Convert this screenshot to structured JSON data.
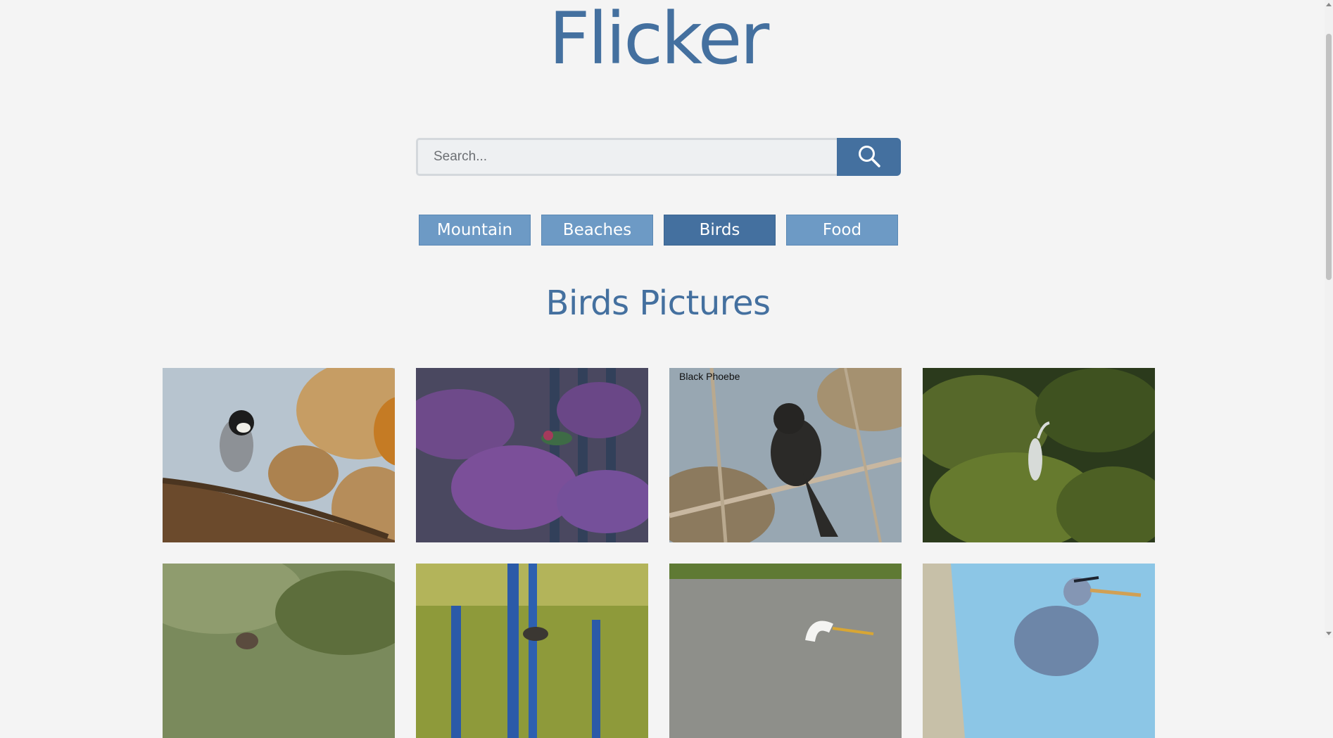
{
  "app": {
    "logo": "Flicker"
  },
  "search": {
    "placeholder": "Search...",
    "value": ""
  },
  "categories": [
    {
      "label": "Mountain",
      "active": false
    },
    {
      "label": "Beaches",
      "active": false
    },
    {
      "label": "Birds",
      "active": true
    },
    {
      "label": "Food",
      "active": false
    }
  ],
  "gallery": {
    "title": "Birds Pictures",
    "photos": [
      {
        "name": "chickadee-photo"
      },
      {
        "name": "hummingbird-photo"
      },
      {
        "name": "black-phoebe-photo",
        "caption": "Black Phoebe"
      },
      {
        "name": "heron-in-trees-photo"
      },
      {
        "name": "blurred-bird-photo"
      },
      {
        "name": "bird-on-fence-photo"
      },
      {
        "name": "egret-photo"
      },
      {
        "name": "great-blue-heron-photo"
      }
    ]
  },
  "colors": {
    "accent": "#44709f",
    "button": "#6d9ac5",
    "button_active": "#44709f",
    "background": "#f4f4f4"
  },
  "icons": {
    "search": "search-icon"
  }
}
